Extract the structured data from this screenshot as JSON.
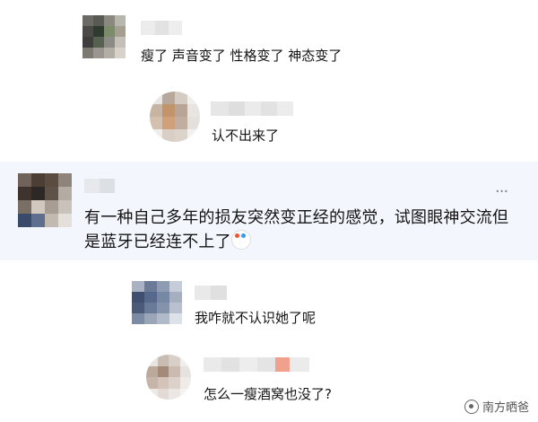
{
  "comments": [
    {
      "text": "瘦了 声音变了 性格变了 神态变了"
    },
    {
      "text": "认不出来了"
    },
    {
      "text": "有一种自己多年的损友突然变正经的感觉，试图眼神交流但是蓝牙已经连不上了",
      "more": "···",
      "emoji": "clown-face-emoji"
    },
    {
      "text": "我咋就不认识她了呢"
    },
    {
      "text": "怎么一瘦酒窝也没了?"
    }
  ],
  "watermark": {
    "text": "南方晒爸",
    "icon": "watermark-logo-icon"
  }
}
